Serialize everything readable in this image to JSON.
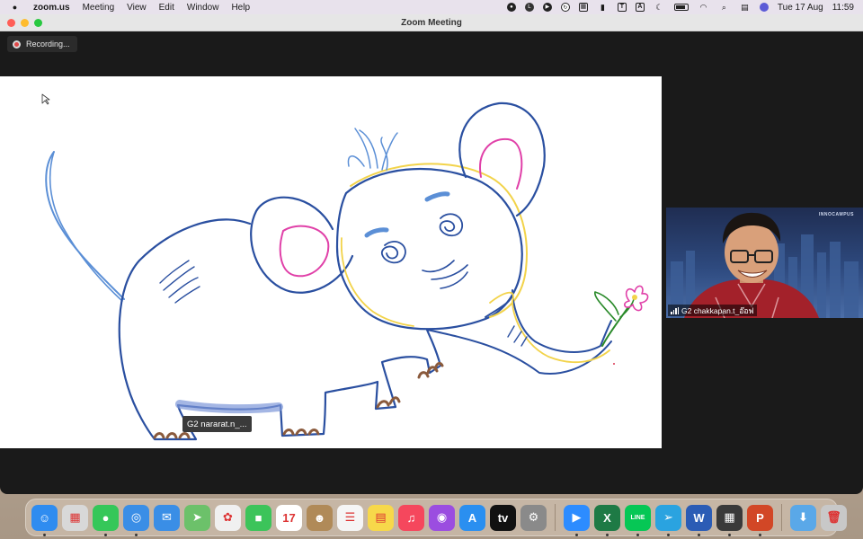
{
  "menubar": {
    "app_name": "zoom.us",
    "menus": [
      "Meeting",
      "View",
      "Edit",
      "Window",
      "Help"
    ],
    "status_icons": [
      "record-icon",
      "line-icon",
      "zoom-icon",
      "refresh-icon",
      "calendar-icon",
      "bell-icon",
      "text-icon",
      "airdrop-icon",
      "moon-icon",
      "battery-icon",
      "wifi-icon",
      "search-icon",
      "control-center-icon",
      "siri-icon"
    ],
    "date": "Tue 17 Aug",
    "time": "11:59"
  },
  "window": {
    "title": "Zoom Meeting"
  },
  "recording": {
    "label": "Recording..."
  },
  "whiteboard": {
    "annotator_tag": "G2 nararat.n_...",
    "colors": {
      "outline": "#2a4fa0",
      "light_blue": "#5b8fd6",
      "pink": "#e040a8",
      "yellow": "#f2d34a",
      "brown": "#8a5a3c",
      "green": "#2a8a2a"
    }
  },
  "video": {
    "participant": "G2 chakkapan.t_อ๊อฟ",
    "logo": "INNOCAMPUS"
  },
  "dock": {
    "apps": [
      {
        "name": "finder-icon",
        "label": "☺",
        "color": "#2f8cf0",
        "running": true
      },
      {
        "name": "launchpad-icon",
        "label": "▦",
        "color": "#d8d8d8",
        "running": false
      },
      {
        "name": "messages-icon",
        "label": "●",
        "color": "#35c759",
        "running": true
      },
      {
        "name": "safari-icon",
        "label": "◎",
        "color": "#3a8ee6",
        "running": true
      },
      {
        "name": "mail-icon",
        "label": "✉",
        "color": "#3a8ee6",
        "running": false
      },
      {
        "name": "maps-icon",
        "label": "➤",
        "color": "#6cc16a",
        "running": false
      },
      {
        "name": "photos-icon",
        "label": "✿",
        "color": "#f0f0f0",
        "running": false
      },
      {
        "name": "facetime-icon",
        "label": "■",
        "color": "#3cc45a",
        "running": false
      },
      {
        "name": "calendar-icon",
        "label": "17",
        "color": "#ffffff",
        "running": false
      },
      {
        "name": "contacts-icon",
        "label": "☻",
        "color": "#b08a58",
        "running": false
      },
      {
        "name": "reminders-icon",
        "label": "☰",
        "color": "#f5f5f5",
        "running": false
      },
      {
        "name": "notes-icon",
        "label": "▤",
        "color": "#f7d84a",
        "running": false
      },
      {
        "name": "music-icon",
        "label": "♫",
        "color": "#f5475d",
        "running": false
      },
      {
        "name": "podcasts-icon",
        "label": "◉",
        "color": "#9b4de0",
        "running": false
      },
      {
        "name": "app-store-icon",
        "label": "A",
        "color": "#2a8ff0",
        "running": false
      },
      {
        "name": "apple-tv-icon",
        "label": "tv",
        "color": "#111111",
        "running": false
      },
      {
        "name": "system-preferences-icon",
        "label": "⚙",
        "color": "#8a8a8a",
        "running": false
      },
      {
        "name": "zoom-icon",
        "label": "▶",
        "color": "#2d8cff",
        "running": true
      },
      {
        "name": "excel-icon",
        "label": "X",
        "color": "#1e7a45",
        "running": true
      },
      {
        "name": "line-icon",
        "label": "LINE",
        "color": "#06c755",
        "running": true
      },
      {
        "name": "telegram-icon",
        "label": "➢",
        "color": "#2aa3e0",
        "running": true
      },
      {
        "name": "word-icon",
        "label": "W",
        "color": "#2b5cb5",
        "running": true
      },
      {
        "name": "calculator-icon",
        "label": "▦",
        "color": "#3a3a3a",
        "running": true
      },
      {
        "name": "powerpoint-icon",
        "label": "P",
        "color": "#d24726",
        "running": true
      },
      {
        "name": "downloads-icon",
        "label": "⬇",
        "color": "#5aa8e8",
        "running": false
      },
      {
        "name": "trash-icon",
        "label": "🗑",
        "color": "#c8c8c8",
        "running": false
      }
    ]
  }
}
